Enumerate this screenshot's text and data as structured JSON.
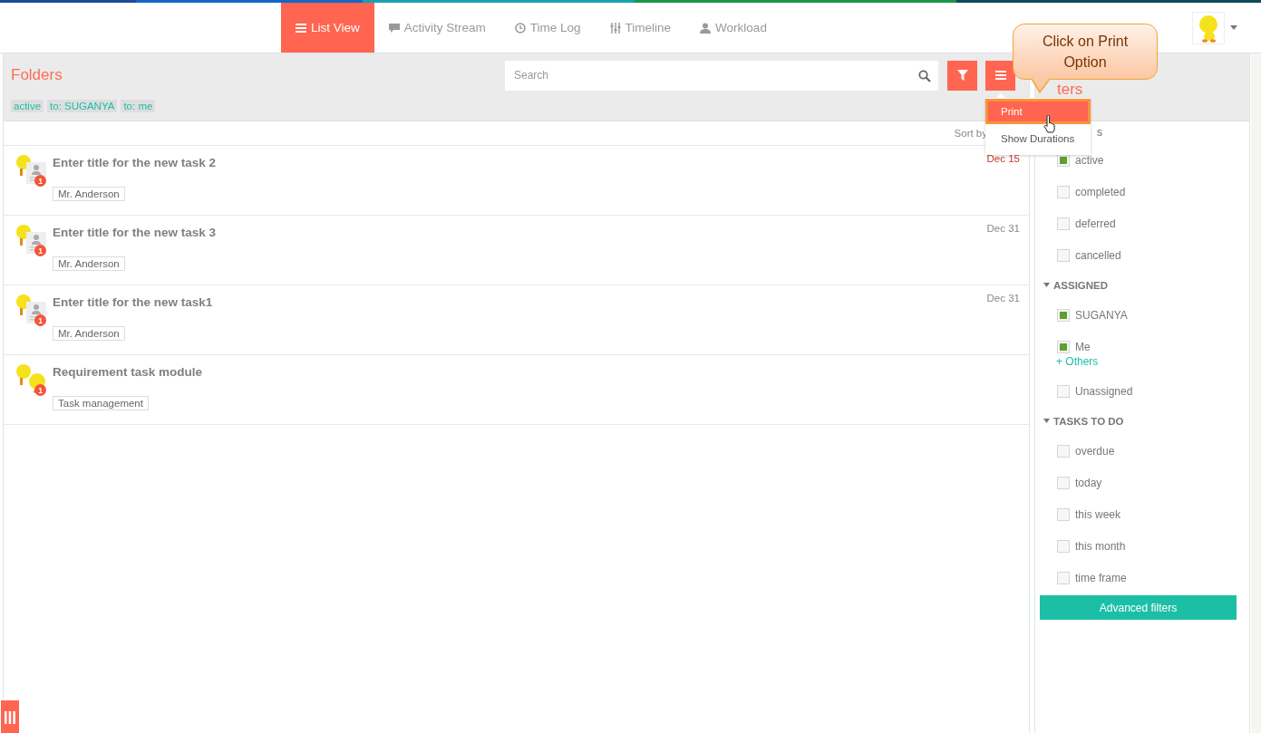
{
  "nav": {
    "tabs": [
      {
        "label": "List View",
        "selected": true
      },
      {
        "label": "Activity Stream",
        "selected": false
      },
      {
        "label": "Time Log",
        "selected": false
      },
      {
        "label": "Timeline",
        "selected": false
      },
      {
        "label": "Workload",
        "selected": false
      }
    ]
  },
  "folders": {
    "title": "Folders",
    "search": {
      "placeholder": "Search"
    },
    "tags": [
      "active",
      "to: SUGANYA",
      "to: me"
    ],
    "sort_label": "Sort by",
    "tasks": [
      {
        "title": "Enter title for the new task 2",
        "tag": "Mr. Anderson",
        "date": "Dec 15",
        "overdue": true,
        "kind": "invite",
        "badge": "1"
      },
      {
        "title": "Enter title for the new task 3",
        "tag": "Mr. Anderson",
        "date": "Dec 31",
        "overdue": false,
        "kind": "invite",
        "badge": "1"
      },
      {
        "title": "Enter title for the new task1",
        "tag": "Mr. Anderson",
        "date": "Dec 31",
        "overdue": false,
        "kind": "invite",
        "badge": "1"
      },
      {
        "title": "Requirement task module",
        "tag": "Task management",
        "kind": "bird",
        "badge": "1"
      }
    ]
  },
  "menu": {
    "items": [
      {
        "label": "Print",
        "selected": true
      },
      {
        "label": "Show Durations",
        "selected": false
      }
    ]
  },
  "callout": {
    "text": "Click on Print Option"
  },
  "filters": {
    "title": "ters",
    "sections": [
      {
        "heading": "s",
        "items": [
          {
            "kind": "checkbox",
            "label": "active",
            "checked": true
          },
          {
            "kind": "checkbox",
            "label": "completed",
            "checked": false
          },
          {
            "kind": "checkbox",
            "label": "deferred",
            "checked": false
          },
          {
            "kind": "checkbox",
            "label": "cancelled",
            "checked": false
          }
        ]
      },
      {
        "heading": "ASSIGNED",
        "expanded": true,
        "items": [
          {
            "kind": "checkbox",
            "label": "SUGANYA",
            "checked": true
          },
          {
            "kind": "checkbox",
            "label": "Me",
            "checked": true
          },
          {
            "kind": "link",
            "label": "+ Others"
          },
          {
            "kind": "checkbox",
            "label": "Unassigned",
            "checked": false
          }
        ]
      },
      {
        "heading": "TASKS TO DO",
        "expanded": true,
        "items": [
          {
            "kind": "checkbox",
            "label": "overdue",
            "checked": false
          },
          {
            "kind": "checkbox",
            "label": "today",
            "checked": false
          },
          {
            "kind": "checkbox",
            "label": "this week",
            "checked": false
          },
          {
            "kind": "checkbox",
            "label": "this month",
            "checked": false
          },
          {
            "kind": "checkbox",
            "label": "time frame",
            "checked": false
          }
        ]
      }
    ],
    "button": "Advanced filters"
  }
}
